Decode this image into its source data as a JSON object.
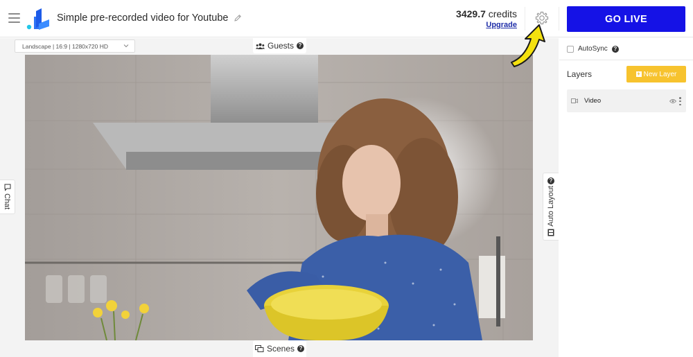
{
  "header": {
    "menu_icon": "hamburger-menu-icon",
    "logo_icon": "brand-logo-icon",
    "title": "Simple pre-recorded video for Youtube",
    "edit_icon": "pencil-icon",
    "credits_value": "3429.7",
    "credits_unit": "credits",
    "upgrade_label": "Upgrade",
    "settings_icon": "gear-icon",
    "go_live_label": "GO LIVE"
  },
  "stage": {
    "resolution": "Landscape | 16:9 | 1280x720 HD",
    "guests_label": "Guests",
    "scenes_label": "Scenes",
    "chat_label": "Chat",
    "auto_layout_label": "Auto Layout",
    "help_glyph": "?"
  },
  "panel": {
    "autosync_label": "AutoSync",
    "layers_title": "Layers",
    "new_layer_label": "New Layer",
    "layers": [
      {
        "name": "Video",
        "icon": "video-camera-icon"
      }
    ]
  },
  "colors": {
    "go_live": "#1512e6",
    "new_layer": "#f7c32e",
    "upgrade_link": "#1f2ea8",
    "annotation_arrow": "#f4e10f"
  }
}
